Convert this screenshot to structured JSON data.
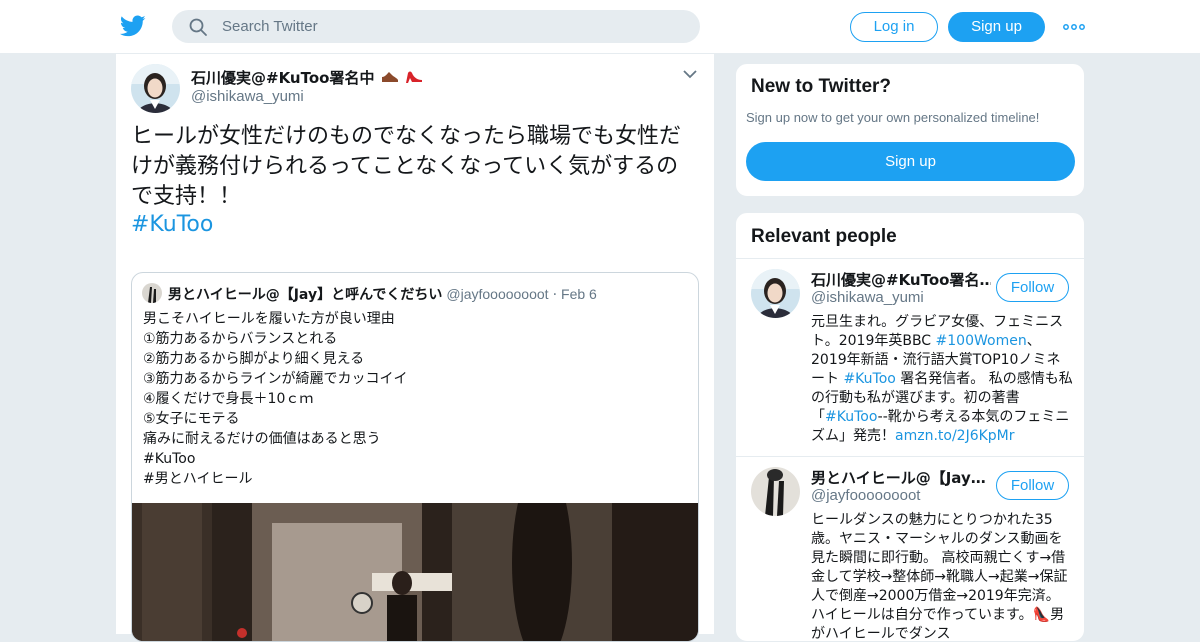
{
  "header": {
    "search_placeholder": "Search Twitter",
    "login_label": "Log in",
    "signup_label": "Sign up",
    "brand_color": "#1da1f2"
  },
  "tweet": {
    "author_name": "石川優実@#KuToo署名中",
    "author_handle": "@ishikawa_yumi",
    "text": "ヒールが女性だけのものでなくなったら職場でも女性だけが義務付けられるってことなくなっていく気がするので支持！！",
    "hashtag": "#KuToo",
    "quoted": {
      "author_name": "男とハイヒール@【Jay】と呼んでくだちい",
      "author_handle": "@jayfoooooooot",
      "separator": "·",
      "date": "Feb 6",
      "lines": [
        "男こそハイヒールを履いた方が良い理由",
        "①筋力あるからバランスとれる",
        "②筋力あるから脚がより細く見える",
        "③筋力あるからラインが綺麗でカッコイイ",
        "④履くだけで身長＋10ｃｍ",
        "⑤女子にモテる",
        "痛みに耐えるだけの価値はあると思う",
        "#KuToo",
        "#男とハイヒール"
      ]
    }
  },
  "sidebar": {
    "new_title": "New to Twitter?",
    "new_subtitle": "Sign up now to get your own personalized timeline!",
    "new_signup_label": "Sign up",
    "relevant_title": "Relevant people",
    "people": [
      {
        "name": "石川優実@#KuToo署名…",
        "handle": "@ishikawa_yumi",
        "follow_label": "Follow",
        "bio_parts": [
          {
            "text": "元旦生まれ。グラビア女優、フェミニスト。2019年英BBC ",
            "link": false
          },
          {
            "text": "#100Women",
            "link": true
          },
          {
            "text": "、2019年新語・流行語大賞TOP10ノミネート ",
            "link": false
          },
          {
            "text": "#KuToo",
            "link": true
          },
          {
            "text": " 署名発信者。 私の感情も私の行動も私が選びます。初の著書「",
            "link": false
          },
          {
            "text": "#KuToo",
            "link": true
          },
          {
            "text": "--靴から考える本気のフェミニズム」発売！",
            "link": false
          },
          {
            "text": "amzn.to/2J6KpMr",
            "link": true
          }
        ]
      },
      {
        "name": "男とハイヒール@【Jay…",
        "handle": "@jayfoooooooot",
        "follow_label": "Follow",
        "bio_parts": [
          {
            "text": "ヒールダンスの魅力にとりつかれた35歳。ヤニス・マーシャルのダンス動画を見た瞬間に即行動。 高校両親亡くす→借金して学校→整体師→靴職人→起業→保証人で倒産→2000万借金→2019年完済。 ハイヒールは自分で作っています。",
            "link": false
          },
          {
            "text": "👠",
            "link": false
          },
          {
            "text": "男がハイヒールでダンス",
            "link": false
          }
        ]
      }
    ]
  }
}
